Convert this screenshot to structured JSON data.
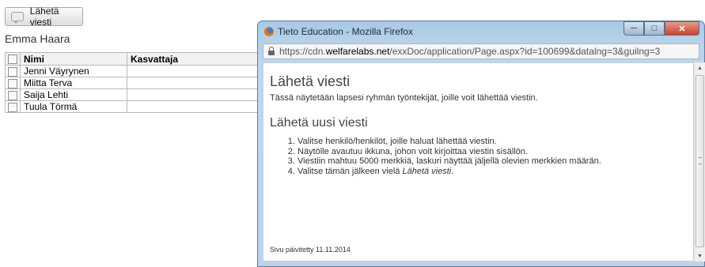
{
  "page": {
    "send_button_label": "Lähetä viesti",
    "child_name": "Emma Haara",
    "table": {
      "headers": {
        "name": "Nimi",
        "role": "Kasvattaja"
      },
      "rows": [
        {
          "name": "Jenni Väyrynen",
          "role": ""
        },
        {
          "name": "Miitta Terva",
          "role": ""
        },
        {
          "name": "Saija Lehti",
          "role": ""
        },
        {
          "name": "Tuula Törmä",
          "role": ""
        }
      ]
    }
  },
  "popup": {
    "window_title": "Tieto Education - Mozilla Firefox",
    "url_prefix": "https://cdn.",
    "url_host": "welfarelabs.net",
    "url_path": "/exxDoc/application/Page.aspx?id=100699&datalng=3&guilng=3",
    "heading": "Lähetä viesti",
    "intro": "Tässä näytetään lapsesi ryhmän työntekijät, joille voit lähettää viestin.",
    "subheading": "Lähetä uusi viesti",
    "steps": [
      "Valitse henkilö/henkilöt, joille haluat lähettää viestin.",
      "Näytölle avautuu ikkuna, johon voit kirjoittaa viestin sisällön.",
      "Viestiin mahtuu 5000 merkkiä, laskuri näyttää jäljellä olevien merkkien määrän."
    ],
    "step4_prefix": "Valitse tämän jälkeen vielä ",
    "step4_emphasis": "Lähetä viesti",
    "step4_suffix": ".",
    "updated": "Sivu päivitetty 11.11.2014"
  },
  "icons": {
    "send": "speech-bubble-icon",
    "browser": "firefox-icon",
    "secure": "lock-icon",
    "minimize": "minimize-icon",
    "maximize": "maximize-icon",
    "close": "close-icon"
  },
  "colors": {
    "window_frame": "#a9c8e6",
    "close_button": "#c8412c"
  }
}
